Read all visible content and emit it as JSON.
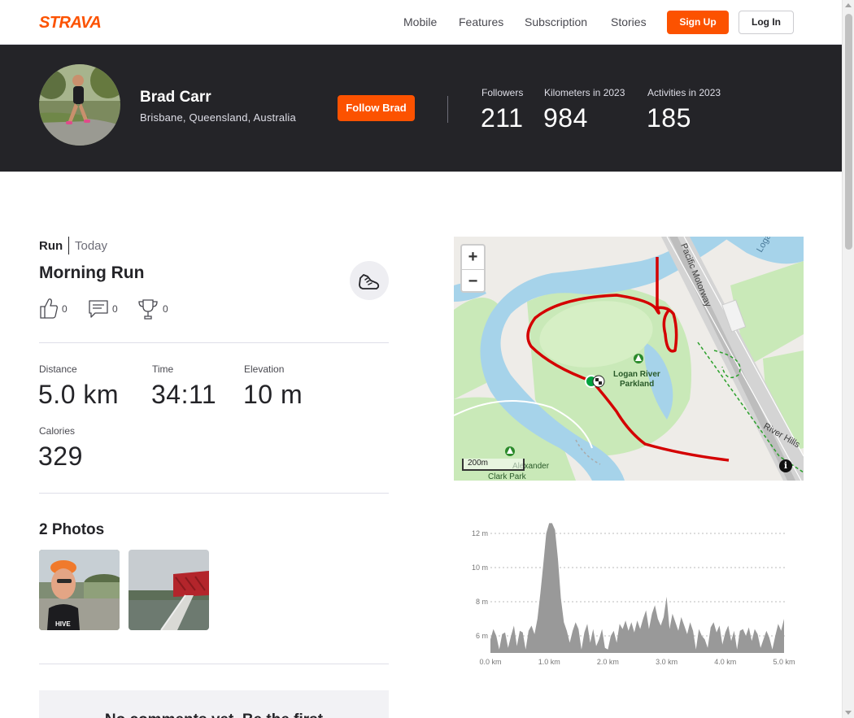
{
  "nav": {
    "brand": "STRAVA",
    "links": [
      "Mobile",
      "Features",
      "Subscription",
      "Stories"
    ],
    "signup": "Sign Up",
    "login": "Log In"
  },
  "athlete": {
    "name": "Brad Carr",
    "location": "Brisbane, Queensland, Australia",
    "follow": "Follow Brad",
    "stats": [
      {
        "label": "Followers",
        "value": "211"
      },
      {
        "label": "Kilometers in 2023",
        "value": "984"
      },
      {
        "label": "Activities in 2023",
        "value": "185"
      }
    ]
  },
  "activity": {
    "type": "Run",
    "date": "Today",
    "title": "Morning Run",
    "kudos": "0",
    "comments": "0",
    "achievements": "0",
    "distance_label": "Distance",
    "distance": "5.0 km",
    "time_label": "Time",
    "time": "34:11",
    "elevation_label": "Elevation",
    "elevation": "10 m",
    "calories_label": "Calories",
    "calories": "329"
  },
  "photos": {
    "title": "2 Photos"
  },
  "comments": {
    "empty": "No comments yet. Be the first"
  },
  "map": {
    "zoom_in": "+",
    "zoom_out": "−",
    "scale": "200m",
    "labels": {
      "motorway": "Pacific Motorway",
      "park": "Logan River Parkland",
      "park2_line1": "Alexander",
      "park2_line2": "Clark Park",
      "road": "River Hills",
      "river": "Logan"
    },
    "info": "i",
    "colors": {
      "route": "#d40000",
      "water": "#a6d3ea",
      "park": "#c9e9b8"
    }
  },
  "chart_data": {
    "type": "area",
    "x_ticks": [
      "0.0 km",
      "1.0 km",
      "2.0 km",
      "3.0 km",
      "4.0 km",
      "5.0 km"
    ],
    "y_ticks": [
      "6 m",
      "8 m",
      "10 m",
      "12 m"
    ],
    "xlim": [
      0,
      5.0
    ],
    "ylim": [
      5,
      13
    ],
    "series": [
      {
        "x": [
          0.0,
          0.05,
          0.1,
          0.15,
          0.2,
          0.25,
          0.3,
          0.35,
          0.4,
          0.45,
          0.5,
          0.55,
          0.6,
          0.65,
          0.7,
          0.75,
          0.8,
          0.85,
          0.9,
          0.95,
          1.0,
          1.05,
          1.1,
          1.15,
          1.2,
          1.25,
          1.3,
          1.35,
          1.4,
          1.45,
          1.5,
          1.55,
          1.6,
          1.65,
          1.7,
          1.75,
          1.8,
          1.85,
          1.9,
          1.95,
          2.0,
          2.05,
          2.1,
          2.15,
          2.2,
          2.25,
          2.3,
          2.35,
          2.4,
          2.45,
          2.5,
          2.55,
          2.6,
          2.65,
          2.7,
          2.75,
          2.8,
          2.85,
          2.9,
          2.95,
          3.0,
          3.05,
          3.1,
          3.15,
          3.2,
          3.25,
          3.3,
          3.35,
          3.4,
          3.45,
          3.5,
          3.55,
          3.6,
          3.65,
          3.7,
          3.75,
          3.8,
          3.85,
          3.9,
          3.95,
          4.0,
          4.05,
          4.1,
          4.15,
          4.2,
          4.25,
          4.3,
          4.35,
          4.4,
          4.45,
          4.5,
          4.55,
          4.6,
          4.65,
          4.7,
          4.75,
          4.8,
          4.85,
          4.9,
          4.95,
          5.0
        ],
        "y": [
          5.8,
          6.4,
          6.0,
          5.2,
          6.1,
          6.2,
          5.3,
          6.0,
          6.6,
          5.4,
          6.3,
          6.2,
          5.2,
          6.3,
          6.6,
          6.1,
          7.0,
          8.5,
          10.2,
          12.0,
          12.6,
          12.6,
          12.2,
          10.5,
          8.2,
          6.8,
          6.3,
          5.6,
          6.3,
          6.8,
          6.4,
          5.2,
          6.2,
          6.7,
          5.6,
          6.4,
          5.4,
          5.8,
          6.4,
          5.3,
          5.2,
          6.0,
          6.3,
          5.6,
          6.7,
          6.4,
          6.9,
          6.3,
          6.8,
          6.2,
          6.9,
          6.4,
          7.0,
          7.5,
          6.4,
          7.3,
          7.8,
          7.0,
          6.6,
          7.1,
          8.3,
          6.4,
          7.3,
          6.8,
          6.3,
          7.1,
          6.6,
          6.1,
          6.8,
          6.3,
          5.2,
          6.4,
          6.0,
          5.8,
          5.3,
          6.5,
          6.8,
          6.2,
          6.6,
          5.5,
          6.2,
          6.6,
          5.7,
          6.3,
          5.2,
          6.3,
          6.4,
          6.0,
          6.5,
          5.7,
          6.4,
          6.1,
          5.3,
          5.8,
          6.3,
          5.9,
          5.2,
          6.0,
          6.7,
          6.3,
          7.0
        ]
      }
    ],
    "grid": true,
    "fill": "#999999"
  }
}
